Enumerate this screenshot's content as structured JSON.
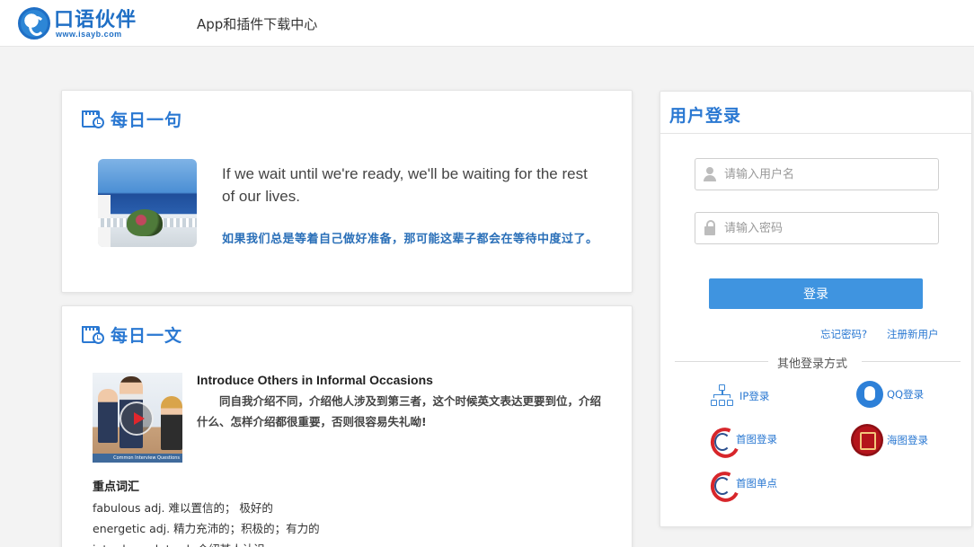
{
  "header": {
    "logo_text": "口语伙伴",
    "logo_url": "www.isayb.com",
    "nav_title": "App和插件下载中心"
  },
  "daily_sentence": {
    "title": "每日一句",
    "english": "If we wait until we're ready, we'll be waiting for the rest of our lives.",
    "chinese": "如果我们总是等着自己做好准备，那可能这辈子都会在等待中度过了。"
  },
  "daily_article": {
    "title": "每日一文",
    "thumb_caption": "Common Interview Questions",
    "article_title": "Introduce Others in Informal Occasions",
    "intro": "同自我介绍不同，介绍他人涉及到第三者，这个时候英文表达更要到位，介绍什么、怎样介绍都很重要，否则很容易失礼呦!",
    "vocab_heading": "重点词汇",
    "vocab": [
      "fabulous  adj. 难以置信的；  极好的",
      "energetic adj.  精力充沛的；积极的；有力的",
      "introduce sb to sb  介绍某人认识"
    ]
  },
  "login": {
    "title": "用户登录",
    "username_placeholder": "请输入用户名",
    "password_placeholder": "请输入密码",
    "submit_label": "登录",
    "forgot_label": "忘记密码?",
    "register_label": "注册新用户",
    "other_label": "其他登录方式",
    "options": {
      "ip": "IP登录",
      "qq": "QQ登录",
      "shoutu": "首图登录",
      "haitu": "海图登录",
      "shoutu_dan": "首图单点"
    }
  },
  "colors": {
    "accent": "#2a78d2",
    "button": "#3f94e0",
    "chinese_text": "#2a6fb8"
  },
  "icons": {
    "daily_sentence": "calendar-clock-icon",
    "daily_article": "calendar-clock-icon",
    "username": "user-icon",
    "password": "lock-icon",
    "ip": "network-icon",
    "qq": "qq-icon",
    "shoutu": "shoutu-logo-icon",
    "haitu": "haitu-seal-icon"
  }
}
